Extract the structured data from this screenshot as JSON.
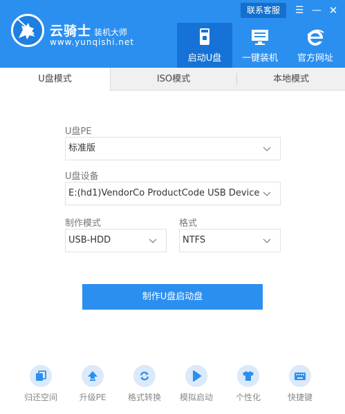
{
  "header": {
    "app_name": "云骑士",
    "app_subtitle": "装机大师",
    "app_url": "www.yunqishi.net",
    "contact_label": "联系客服",
    "menu_glyph": "☰",
    "minimize_glyph": "—",
    "close_glyph": "✕",
    "nav": [
      {
        "label": "启动U盘",
        "icon": "usb-drive-icon",
        "active": true
      },
      {
        "label": "一键装机",
        "icon": "monitor-icon",
        "active": false
      },
      {
        "label": "官方网址",
        "icon": "ie-browser-icon",
        "active": false
      }
    ]
  },
  "tabs": [
    {
      "label": "U盘模式",
      "active": true
    },
    {
      "label": "ISO模式",
      "active": false
    },
    {
      "label": "本地模式",
      "active": false
    }
  ],
  "form": {
    "pe_label": "U盘PE",
    "pe_value": "标准版",
    "device_label": "U盘设备",
    "device_value": "E:(hd1)VendorCo ProductCode USB Device",
    "mode_label": "制作模式",
    "mode_value": "USB-HDD",
    "format_label": "格式",
    "format_value": "NTFS"
  },
  "action": {
    "make_label": "制作U盘启动盘"
  },
  "tools": [
    {
      "label": "归还空间",
      "icon": "restore-space-icon"
    },
    {
      "label": "升级PE",
      "icon": "upgrade-icon"
    },
    {
      "label": "格式转换",
      "icon": "convert-icon"
    },
    {
      "label": "模拟启动",
      "icon": "simulate-play-icon"
    },
    {
      "label": "个性化",
      "icon": "shirt-icon"
    },
    {
      "label": "快捷键",
      "icon": "keyboard-icon"
    }
  ],
  "colors": {
    "primary": "#2b8ff0",
    "header_active": "#1672d6",
    "tool_circle": "#dbe9f9"
  }
}
